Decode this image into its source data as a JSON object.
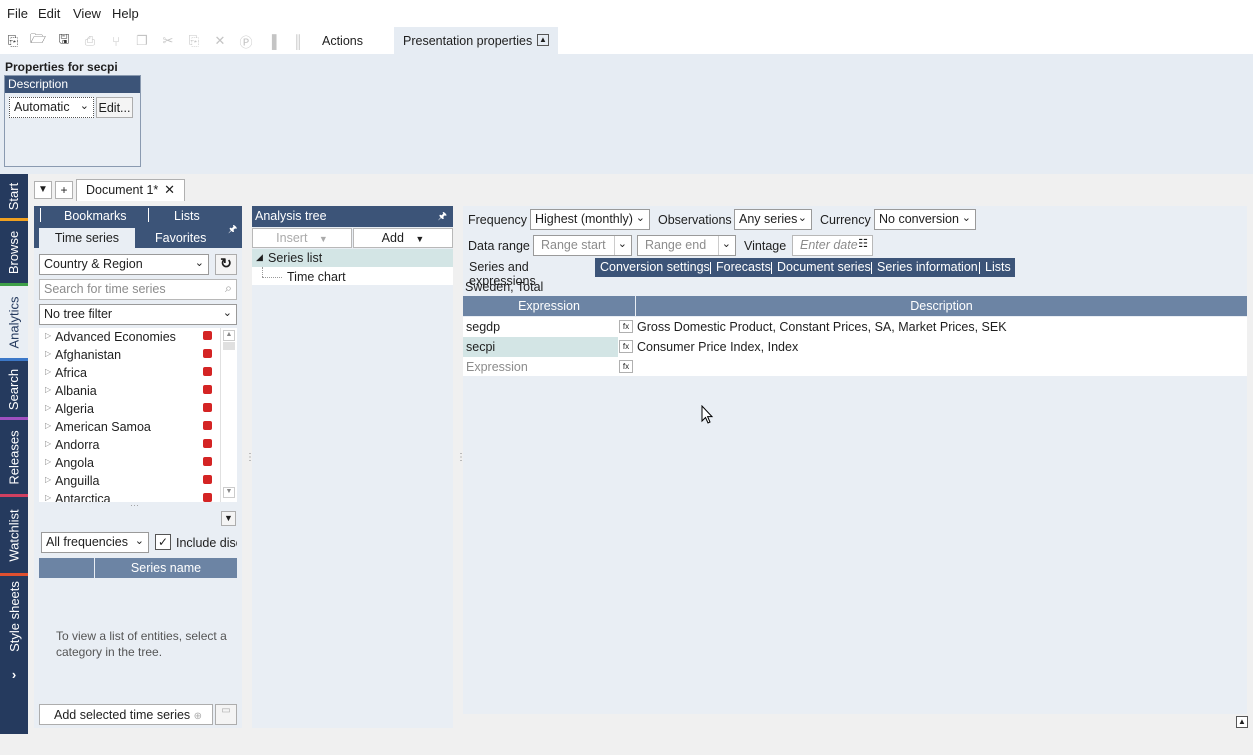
{
  "menu": [
    "File",
    "Edit",
    "View",
    "Help"
  ],
  "toolbar": {
    "actions_label": "Actions",
    "presentation_label": "Presentation properties"
  },
  "ribbon": {
    "properties_title": "Properties for secpi",
    "description_header": "Description",
    "description_mode": "Automatic",
    "edit_button": "Edit..."
  },
  "sidebar": {
    "tabs": [
      "Start",
      "Browse",
      "Analytics",
      "Search",
      "Releases",
      "Watchlist",
      "Style sheets"
    ],
    "active": "Analytics",
    "expand_glyph": "›"
  },
  "document": {
    "tab_label": "Document 1*"
  },
  "browse": {
    "tabs_top": [
      "Bookmarks",
      "Lists"
    ],
    "tabs_bottom": [
      "Time series",
      "Favorites"
    ],
    "category_select": "Country & Region",
    "search_placeholder": "Search for time series",
    "tree_filter": "No tree filter",
    "tree_items": [
      "Advanced Economies",
      "Afghanistan",
      "Africa",
      "Albania",
      "Algeria",
      "American Samoa",
      "Andorra",
      "Angola",
      "Anguilla",
      "Antarctica"
    ],
    "frequency_select": "All frequencies",
    "include_label": "Include disc",
    "grid_header_name": "Series name",
    "empty_message": "To view a list of entities, select a category in the tree.",
    "add_button": "Add selected time series"
  },
  "analysis": {
    "header": "Analysis tree",
    "insert_label": "Insert",
    "add_label": "Add",
    "series_list": "Series list",
    "time_chart": "Time chart"
  },
  "settings": {
    "frequency_label": "Frequency",
    "frequency_value": "Highest (monthly)",
    "observations_label": "Observations",
    "observations_value": "Any series",
    "currency_label": "Currency",
    "currency_value": "No conversion",
    "data_range_label": "Data range",
    "range_start_placeholder": "Range start",
    "range_end_placeholder": "Range end",
    "vintage_label": "Vintage",
    "vintage_placeholder": "Enter date"
  },
  "subtabs": [
    "Series and expressions",
    "Conversion settings",
    "Forecasts",
    "Document series",
    "Series information",
    "Lists"
  ],
  "region_label": "Sweden, Total",
  "expressions": {
    "col_expression": "Expression",
    "col_description": "Description",
    "rows": [
      {
        "expr": "segdp",
        "desc": "Gross Domestic Product, Constant Prices, SA, Market Prices, SEK"
      },
      {
        "expr": "secpi",
        "desc": "Consumer Price Index, Index"
      }
    ],
    "new_row_placeholder": "Expression",
    "fx_label": "fx"
  },
  "colors": {
    "navy": "#253a5e",
    "header_blue": "#3c5478",
    "panel_bg": "#e9eef4",
    "selected_row": "#d3e5e5"
  }
}
